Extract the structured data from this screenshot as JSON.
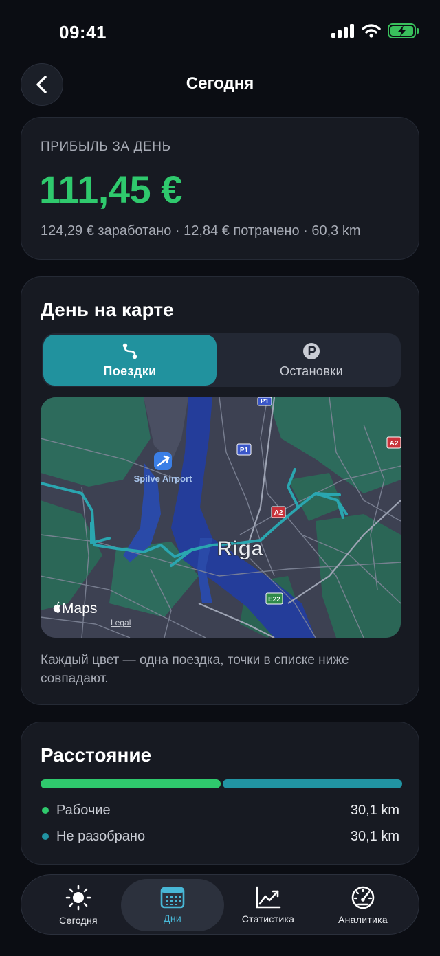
{
  "status_bar": {
    "time": "09:41"
  },
  "nav": {
    "title": "Сегодня"
  },
  "profit": {
    "label": "ПРИБЫЛЬ ЗА ДЕНЬ",
    "value": "111,45 €",
    "summary": "124,29 € заработано · 12,84 € потрачено · 60,3 km",
    "accent_color": "#2fc96d"
  },
  "map_card": {
    "title": "День на карте",
    "tabs": [
      {
        "label": "Поездки",
        "active": true
      },
      {
        "label": "Остановки",
        "active": false
      }
    ],
    "map": {
      "city_label": "Riga",
      "airport_label": "Spilve Airport",
      "road_labels": [
        "P1",
        "P1",
        "A2",
        "A2",
        "E22"
      ],
      "brand": "Maps",
      "legal": "Legal",
      "route_color": "#2aa6b0"
    },
    "caption": "Каждый цвет — одна поездка, точки в списке ниже совпадают."
  },
  "distance": {
    "title": "Расстояние",
    "segments": [
      {
        "label": "Рабочие",
        "value": "30,1 km",
        "fraction": 0.5,
        "color": "#2fc96d"
      },
      {
        "label": "Не разобрано",
        "value": "30,1 km",
        "fraction": 0.5,
        "color": "#2194a3"
      }
    ]
  },
  "tab_bar": {
    "items": [
      {
        "label": "Сегодня",
        "icon": "sun-icon",
        "active": false
      },
      {
        "label": "Дни",
        "icon": "calendar-icon",
        "active": true
      },
      {
        "label": "Статистика",
        "icon": "chart-line-icon",
        "active": false
      },
      {
        "label": "Аналитика",
        "icon": "speedometer-icon",
        "active": false
      }
    ]
  }
}
